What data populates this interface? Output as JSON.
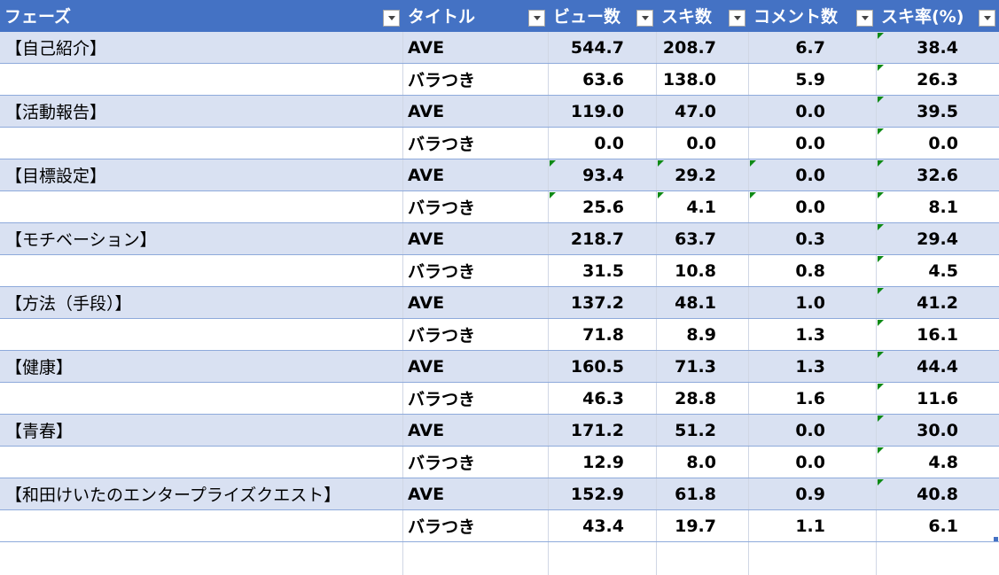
{
  "table": {
    "headers": [
      {
        "label": "フェーズ",
        "filter_icon": "filter-dropdown-icon"
      },
      {
        "label": "タイトル",
        "filter_icon": "filter-dropdown-icon"
      },
      {
        "label": "ビュー数",
        "filter_icon": "filter-dropdown-icon"
      },
      {
        "label": "スキ数",
        "filter_icon": "filter-dropdown-icon"
      },
      {
        "label": "コメント数",
        "filter_icon": "filter-dropdown-icon"
      },
      {
        "label": "スキ率(%)",
        "filter_icon": "filter-dropdown-icon"
      }
    ],
    "rows": [
      {
        "phase": "【自己紹介】",
        "title": "AVE",
        "views": "544.7",
        "likes": "208.7",
        "comments": "6.7",
        "rate": "38.4",
        "band": true,
        "marks": [
          false,
          false,
          false,
          true
        ]
      },
      {
        "phase": "",
        "title": "バラつき",
        "views": "63.6",
        "likes": "138.0",
        "comments": "5.9",
        "rate": "26.3",
        "band": false,
        "marks": [
          false,
          false,
          false,
          true
        ]
      },
      {
        "phase": "【活動報告】",
        "title": "AVE",
        "views": "119.0",
        "likes": "47.0",
        "comments": "0.0",
        "rate": "39.5",
        "band": true,
        "marks": [
          false,
          false,
          false,
          true
        ]
      },
      {
        "phase": "",
        "title": "バラつき",
        "views": "0.0",
        "likes": "0.0",
        "comments": "0.0",
        "rate": "0.0",
        "band": false,
        "marks": [
          false,
          false,
          false,
          true
        ]
      },
      {
        "phase": "【目標設定】",
        "title": "AVE",
        "views": "93.4",
        "likes": "29.2",
        "comments": "0.0",
        "rate": "32.6",
        "band": true,
        "marks": [
          true,
          true,
          true,
          true
        ]
      },
      {
        "phase": "",
        "title": "バラつき",
        "views": "25.6",
        "likes": "4.1",
        "comments": "0.0",
        "rate": "8.1",
        "band": false,
        "marks": [
          true,
          true,
          true,
          true
        ]
      },
      {
        "phase": "【モチベーション】",
        "title": "AVE",
        "views": "218.7",
        "likes": "63.7",
        "comments": "0.3",
        "rate": "29.4",
        "band": true,
        "marks": [
          false,
          false,
          false,
          true
        ]
      },
      {
        "phase": "",
        "title": "バラつき",
        "views": "31.5",
        "likes": "10.8",
        "comments": "0.8",
        "rate": "4.5",
        "band": false,
        "marks": [
          false,
          false,
          false,
          true
        ]
      },
      {
        "phase": "【方法（手段）】",
        "title": "AVE",
        "views": "137.2",
        "likes": "48.1",
        "comments": "1.0",
        "rate": "41.2",
        "band": true,
        "marks": [
          false,
          false,
          false,
          true
        ]
      },
      {
        "phase": "",
        "title": "バラつき",
        "views": "71.8",
        "likes": "8.9",
        "comments": "1.3",
        "rate": "16.1",
        "band": false,
        "marks": [
          false,
          false,
          false,
          true
        ]
      },
      {
        "phase": "【健康】",
        "title": "AVE",
        "views": "160.5",
        "likes": "71.3",
        "comments": "1.3",
        "rate": "44.4",
        "band": true,
        "marks": [
          false,
          false,
          false,
          true
        ]
      },
      {
        "phase": "",
        "title": "バラつき",
        "views": "46.3",
        "likes": "28.8",
        "comments": "1.6",
        "rate": "11.6",
        "band": false,
        "marks": [
          false,
          false,
          false,
          true
        ]
      },
      {
        "phase": "【青春】",
        "title": "AVE",
        "views": "171.2",
        "likes": "51.2",
        "comments": "0.0",
        "rate": "30.0",
        "band": true,
        "marks": [
          false,
          false,
          false,
          true
        ]
      },
      {
        "phase": "",
        "title": "バラつき",
        "views": "12.9",
        "likes": "8.0",
        "comments": "0.0",
        "rate": "4.8",
        "band": false,
        "marks": [
          false,
          false,
          false,
          true
        ]
      },
      {
        "phase": "【和田けいたのエンタープライズクエスト】",
        "title": "AVE",
        "views": "152.9",
        "likes": "61.8",
        "comments": "0.9",
        "rate": "40.8",
        "band": true,
        "marks": [
          false,
          false,
          false,
          true
        ]
      },
      {
        "phase": "",
        "title": "バラつき",
        "views": "43.4",
        "likes": "19.7",
        "comments": "1.1",
        "rate": "6.1",
        "band": false,
        "marks": [
          false,
          false,
          false,
          false
        ]
      }
    ]
  },
  "colors": {
    "header_bg": "#4472c4",
    "band_bg": "#d9e1f2",
    "comment_indicator": "#0e8a16"
  }
}
